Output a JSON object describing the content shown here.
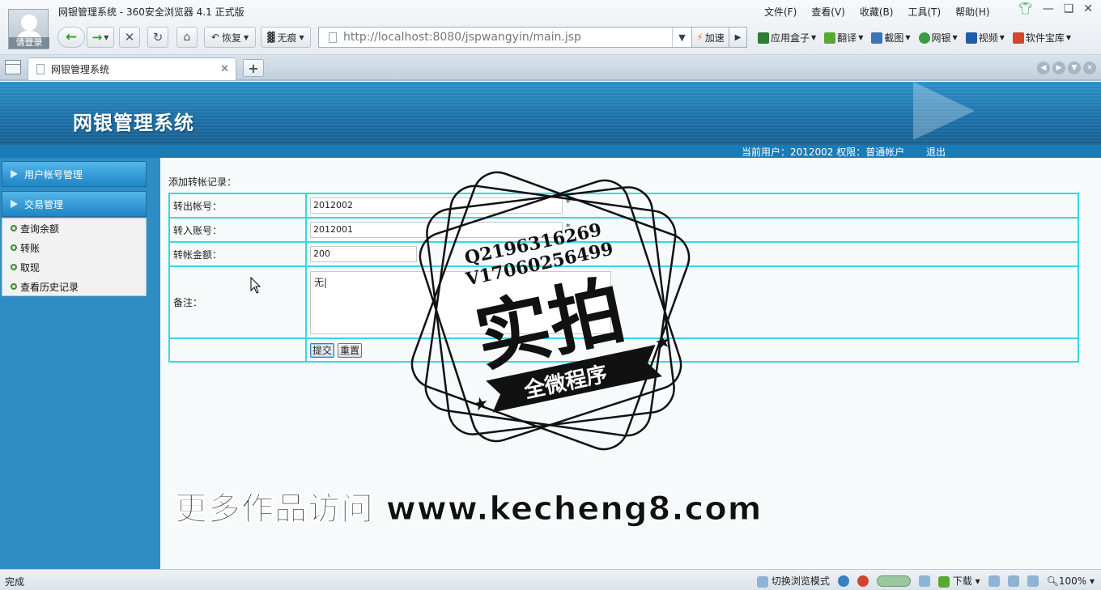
{
  "browser": {
    "window_title": "网银管理系统 - 360安全浏览器 4.1 正式版",
    "avatar_label": "请登录",
    "menu": [
      "文件(F)",
      "查看(V)",
      "收藏(B)",
      "工具(T)",
      "帮助(H)"
    ],
    "restore_label": "恢复",
    "incognito_label": "无痕",
    "url": "http://localhost:8080/jspwangyin/main.jsp",
    "speed_label": "加速",
    "extensions": [
      {
        "label": "应用盒子",
        "color": "#2e7d32"
      },
      {
        "label": "翻译",
        "color": "#5aa832"
      },
      {
        "label": "截图",
        "color": "#3d74b8"
      },
      {
        "label": "网银",
        "color": "#3a9a45"
      },
      {
        "label": "视频",
        "color": "#1f5fa8"
      },
      {
        "label": "软件宝库",
        "color": "#d4452f"
      }
    ],
    "tab_title": "网银管理系统"
  },
  "app": {
    "title": "网银管理系统",
    "current_user": "当前用户：2012002 权限：普通帐户",
    "logout": "退出",
    "sidebar": {
      "group1": "用户帐号管理",
      "group2": "交易管理",
      "items": [
        "查询余额",
        "转账",
        "取现",
        "查看历史记录"
      ]
    },
    "form": {
      "section_title": "添加转帐记录：",
      "from_label": "转出帐号：",
      "from_value": "2012002",
      "to_label": "转入账号：",
      "to_value": "2012001",
      "amount_label": "转帐金额：",
      "amount_value": "200",
      "required_mark": "*",
      "remark_label": "备注：",
      "remark_value": "无|",
      "submit_label": "提交",
      "reset_label": "重置"
    }
  },
  "watermark": {
    "line1": "Q2196316269",
    "line2": "V17060256499",
    "big": "实拍",
    "ribbon": "全微程序",
    "site": "更多作品访问 www.kecheng8.com"
  },
  "statusbar": {
    "left": "完成",
    "mode": "切换浏览模式",
    "download": "下载",
    "zoom": "100%"
  }
}
